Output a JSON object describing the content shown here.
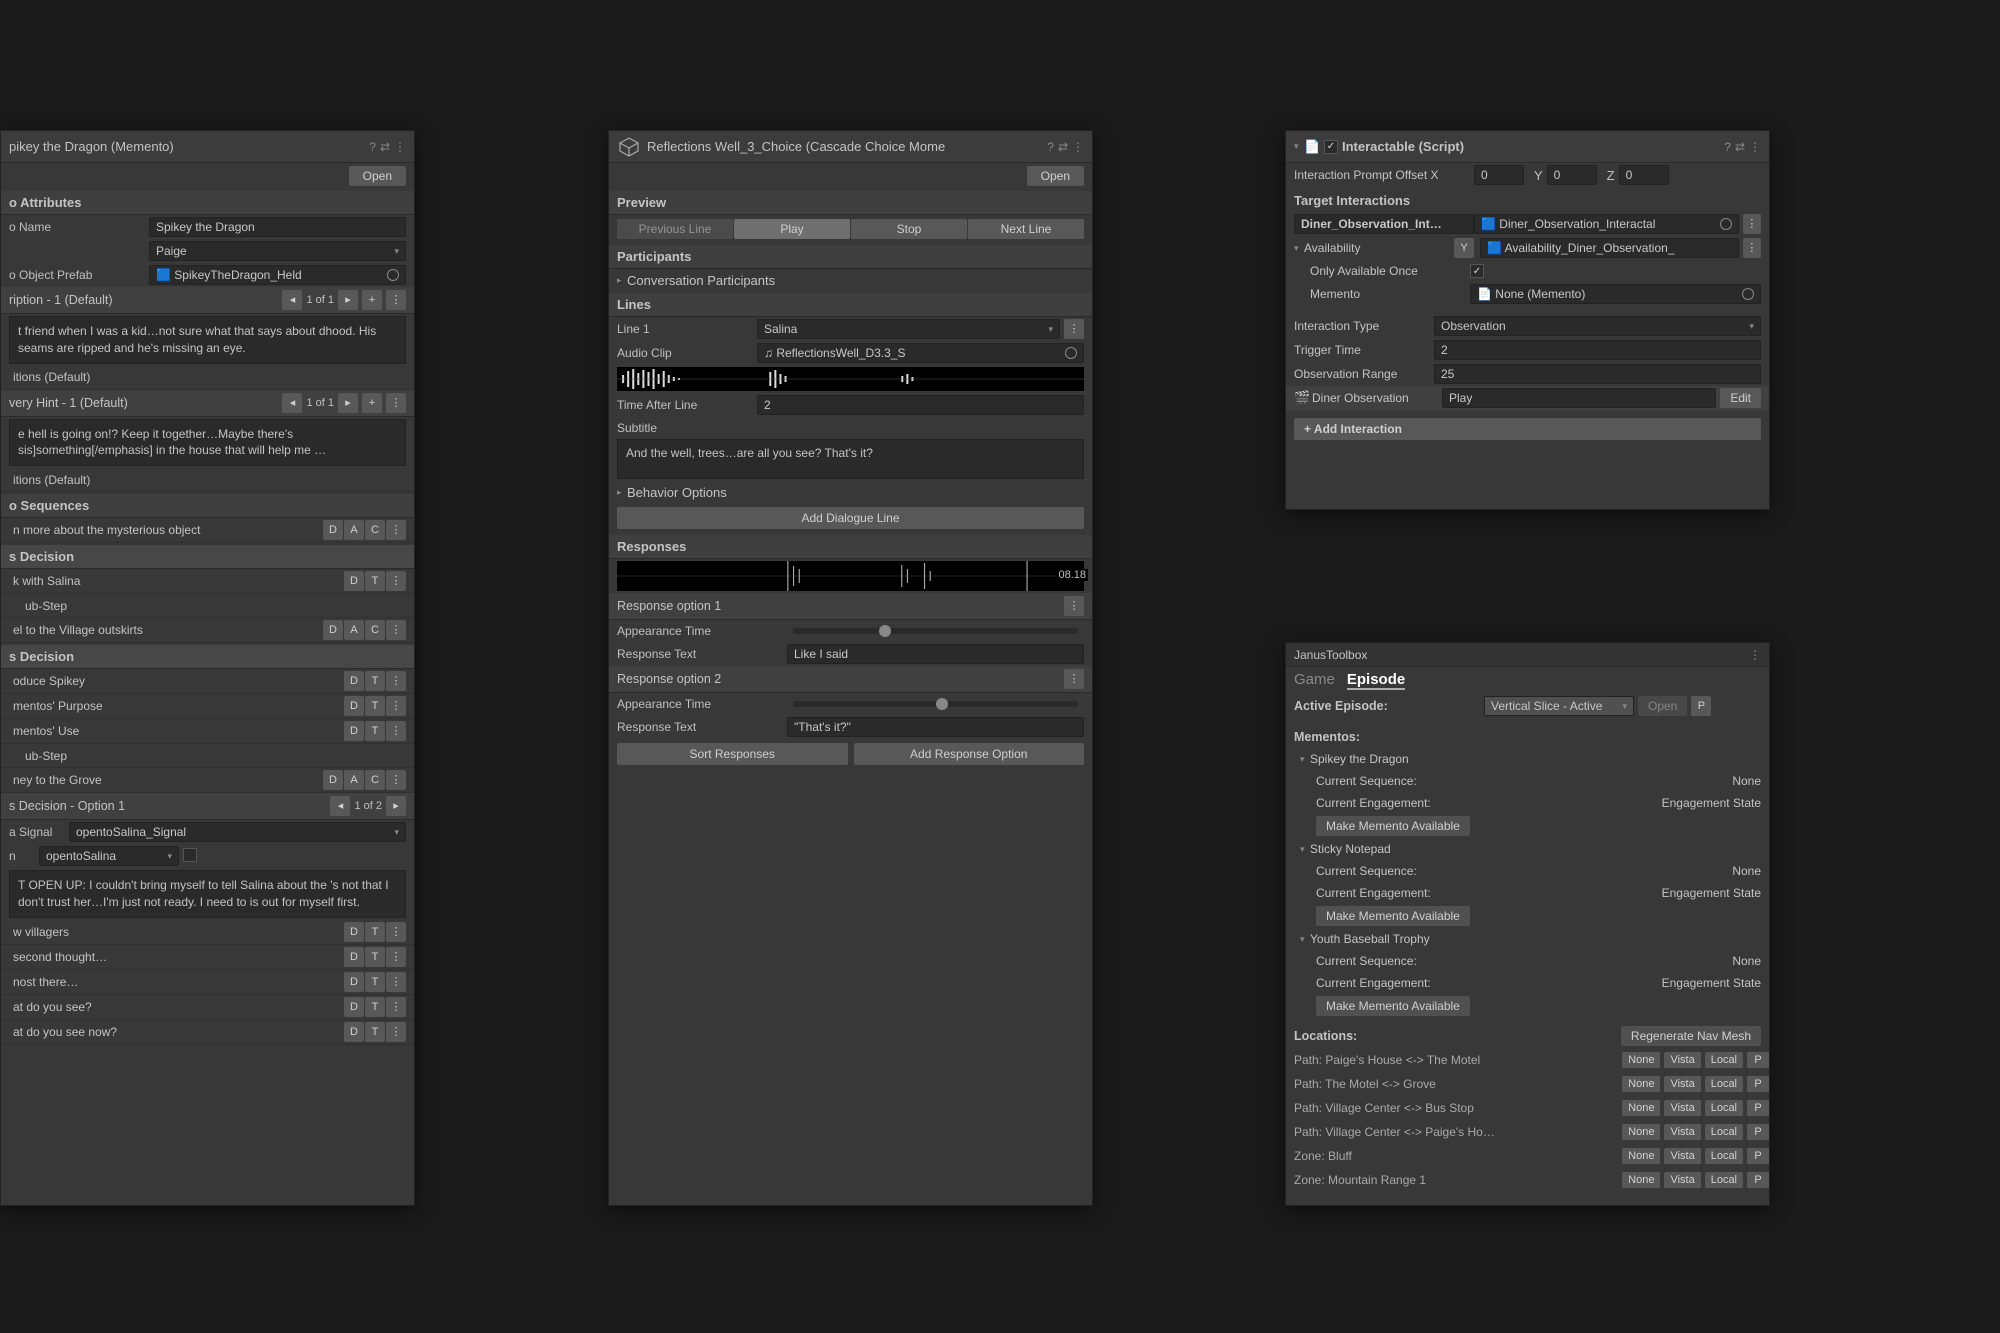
{
  "panel1": {
    "title": "pikey the Dragon (Memento)",
    "open": "Open",
    "attrs_header": "o Attributes",
    "name_label": "o Name",
    "name_value": "Spikey the Dragon",
    "owner_value": "Paige",
    "prefab_label": "o Object Prefab",
    "prefab_value": "SpikeyTheDragon_Held",
    "desc_header": "ription - 1 (Default)",
    "pager1": "1 of 1",
    "desc_text": "t friend when I was a kid…not sure what that says about dhood. His seams are ripped and he's missing an eye.",
    "cond1": "itions (Default)",
    "hint_header": "very Hint - 1 (Default)",
    "pager2": "1 of 1",
    "hint_text": "e hell is going on!? Keep it together…Maybe there's sis]something[/emphasis] in the house that will help me …",
    "cond2": "itions (Default)",
    "seq_header": "o Sequences",
    "seq_title": "n more about the mysterious object",
    "dec1": "s Decision",
    "item1": "k with Salina",
    "item2": "ub-Step",
    "item3": "el to the Village outskirts",
    "dec2": "s Decision",
    "item4": "oduce Spikey",
    "item5": "mentos' Purpose",
    "item6": "mentos' Use",
    "item7": "ub-Step",
    "item8": "ney to the Grove",
    "dec3_header": "s Decision - Option 1",
    "pager3": "1 of 2",
    "signal_label": "a Signal",
    "signal_value": "opentoSalina_Signal",
    "n_label": "n",
    "n_value": "opentoSalina",
    "dec3_text": "T OPEN UP: I couldn't bring myself to tell Salina about the  's not that I don't trust her…I'm just not ready. I need to is out for myself first.",
    "item9": "w villagers",
    "item10": "second thought…",
    "item11": "nost there…",
    "item12": "at do you see?",
    "item13": "at do you see now?",
    "d": "D",
    "a": "A",
    "c": "C",
    "t": "T"
  },
  "panel2": {
    "title": "Reflections Well_3_Choice (Cascade Choice Mome",
    "open": "Open",
    "preview": "Preview",
    "prev_line": "Previous Line",
    "play": "Play",
    "stop": "Stop",
    "next_line": "Next Line",
    "participants": "Participants",
    "conv_part": "Conversation Participants",
    "lines": "Lines",
    "line1": "Line 1",
    "speaker": "Salina",
    "audio_clip_label": "Audio Clip",
    "audio_clip_value": "ReflectionsWell_D3.3_S",
    "time_after_label": "Time After Line",
    "time_after_value": "2",
    "subtitle_label": "Subtitle",
    "subtitle_text": "And the well, trees…are all you see? That's it?",
    "behavior_opts": "Behavior Options",
    "add_dialogue": "Add Dialogue Line",
    "responses": "Responses",
    "wf_time": "08.18",
    "resp1": "Response option 1",
    "appear_time": "Appearance Time",
    "resp_text_label": "Response Text",
    "resp1_text": "Like I said",
    "resp2": "Response option 2",
    "resp2_text": "\"That's it?\"",
    "sort": "Sort Responses",
    "add_resp": "Add Response Option"
  },
  "panel3": {
    "title": "Interactable (Script)",
    "offset_label": "Interaction Prompt Offset X",
    "x": "0",
    "y_lbl": "Y",
    "y": "0",
    "z_lbl": "Z",
    "z": "0",
    "target": "Target Interactions",
    "int_name": "Diner_Observation_Int…",
    "int_obj": "Diner_Observation_Interactal",
    "avail": "Availability",
    "avail_y": "Y",
    "avail_obj": "Availability_Diner_Observation_",
    "only_once": "Only Available Once",
    "memento": "Memento",
    "memento_val": "None (Memento)",
    "int_type": "Interaction Type",
    "int_type_val": "Observation",
    "trig_time": "Trigger Time",
    "trig_time_val": "2",
    "obs_range": "Observation Range",
    "obs_range_val": "25",
    "diner_obs": "Diner Observation",
    "play": "Play",
    "edit": "Edit",
    "add_int": "+ Add Interaction"
  },
  "panel4": {
    "title": "JanusToolbox",
    "game": "Game",
    "episode": "Episode",
    "active_ep": "Active Episode:",
    "ep_value": "Vertical Slice - Active",
    "open": "Open",
    "p": "P",
    "mementos_hdr": "Mementos:",
    "mementos": [
      {
        "name": "Spikey the Dragon",
        "seq": "None",
        "eng": "Engagement State"
      },
      {
        "name": "Sticky Notepad",
        "seq": "None",
        "eng": "Engagement State"
      },
      {
        "name": "Youth Baseball Trophy",
        "seq": "None",
        "eng": "Engagement State"
      }
    ],
    "cur_seq": "Current Sequence:",
    "cur_eng": "Current Engagement:",
    "make_avail": "Make Memento Available",
    "locations": "Locations:",
    "regen": "Regenerate Nav Mesh",
    "paths": [
      "Path: Paige's House <-> The Motel",
      "Path: The Motel <-> Grove",
      "Path: Village Center <-> Bus Stop",
      "Path: Village Center <-> Paige's Ho…",
      "Zone: Bluff",
      "Zone: Mountain Range 1"
    ],
    "none": "None",
    "vista": "Vista",
    "local": "Local",
    "pp": "P"
  }
}
